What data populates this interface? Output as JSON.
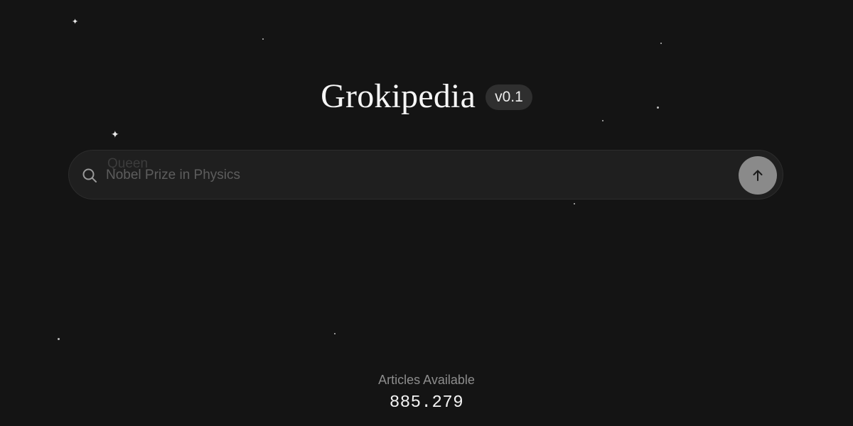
{
  "header": {
    "title": "Grokipedia",
    "version": "v0.1"
  },
  "search": {
    "ghost_suggestion": "Queen",
    "placeholder": "Nobel Prize in Physics",
    "value": "",
    "search_icon": "search-icon",
    "submit_icon": "arrow-up-icon"
  },
  "stats": {
    "label": "Articles Available",
    "value": "885.279"
  },
  "colors": {
    "background": "#141414",
    "search_bar": "#1f1f1f",
    "submit_button": "#8a8a8a",
    "badge": "#2f2f2f"
  }
}
